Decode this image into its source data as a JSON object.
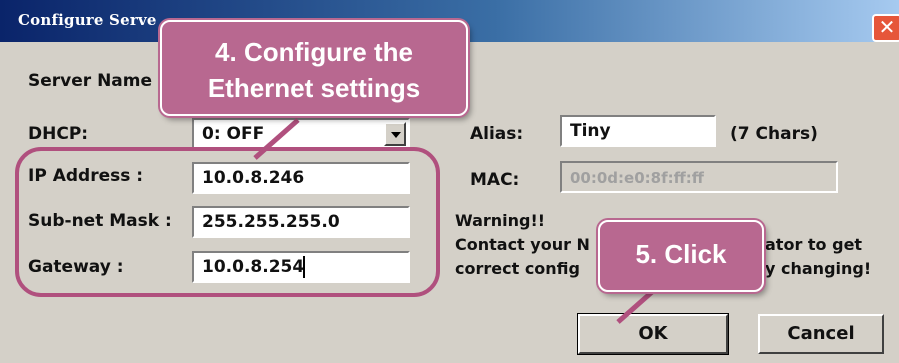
{
  "window": {
    "title": "Configure Serve",
    "close_glyph": "✕"
  },
  "form": {
    "server_name_label": "Server Name",
    "dhcp_label": "DHCP:",
    "dhcp_value": "0: OFF",
    "ip_label": "IP Address :",
    "ip_value": "10.0.8.246",
    "subnet_label": "Sub-net Mask :",
    "subnet_value": "255.255.255.0",
    "gateway_label": "Gateway :",
    "gateway_value": "10.0.8.254",
    "alias_label": "Alias:",
    "alias_value": "Tiny",
    "alias_hint": "(7 Chars)",
    "mac_label": "MAC:",
    "mac_value": "00:0d:e0:8f:ff:ff"
  },
  "warning": {
    "title": "Warning!!",
    "line1_left": "Contact your N",
    "line1_right": "ator to get",
    "line2_left": "correct  config",
    "line2_right": "y changing!"
  },
  "buttons": {
    "ok": "OK",
    "cancel": "Cancel"
  },
  "callouts": {
    "step4_line1": "4. Configure the",
    "step4_line2": "Ethernet settings",
    "step5": "5. Click"
  },
  "colors": {
    "callout": "#b86890",
    "outline": "#b0507e",
    "titlebar": "#0a246a"
  }
}
